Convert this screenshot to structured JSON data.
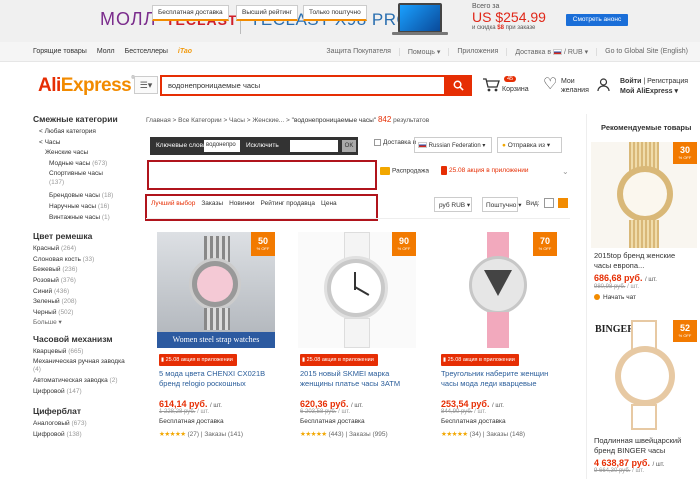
{
  "banner": {
    "mall": "МОЛЛ",
    "brand": "TECLAST",
    "product": "TECLAST X98 PRO",
    "offer_line1": "Всего за",
    "offer_price": "US $254.99",
    "offer_line3_prefix": "и скидка",
    "offer_line3_amount": "$8",
    "offer_line3_suffix": "при заказе",
    "cta": "Смотреть анонс"
  },
  "topnav": {
    "left": [
      "Горящие товары",
      "Молл",
      "Бестселлеры",
      "iTao"
    ],
    "right": [
      "Защита Покупателя",
      "Помощь ▾",
      "Приложения",
      "Доставка в",
      "/ RUB ▾",
      "Go to Global Site (English)"
    ]
  },
  "header": {
    "logo_main": "Ali",
    "logo_accent": "Express",
    "logo_reg": "®",
    "search_value": "водонепроницаемые часы",
    "cart_count": "45",
    "cart_label": "Корзина",
    "wish_label": "Мои желания",
    "account_line1a": "Войти",
    "account_line1b": "Регистрация",
    "account_line2": "Мой AliExpress ▾"
  },
  "sidebar": {
    "heading_categories": "Смежные категории",
    "categories": [
      {
        "label": "< Любая категория",
        "count": "",
        "level": 1
      },
      {
        "label": "< Часы",
        "count": "",
        "level": 2
      },
      {
        "label": "Женские часы",
        "count": "",
        "level": 2
      },
      {
        "label": "Модные часы",
        "count": "(673)",
        "level": 3
      },
      {
        "label": "Спортивные часы",
        "count": "(137)",
        "level": 3
      },
      {
        "label": "Брендовые часы",
        "count": "(18)",
        "level": 3
      },
      {
        "label": "Наручные часы",
        "count": "(16)",
        "level": 3
      },
      {
        "label": "Винтажные часы",
        "count": "(1)",
        "level": 3
      }
    ],
    "heading_strap": "Цвет ремешка",
    "strap": [
      {
        "label": "Красный",
        "count": "(264)"
      },
      {
        "label": "Слоновая кость",
        "count": "(33)"
      },
      {
        "label": "Бежевый",
        "count": "(236)"
      },
      {
        "label": "Розовый",
        "count": "(376)"
      },
      {
        "label": "Синий",
        "count": "(436)"
      },
      {
        "label": "Зеленый",
        "count": "(208)"
      },
      {
        "label": "Черный",
        "count": "(502)"
      }
    ],
    "more": "Больше ▾",
    "heading_mech": "Часовой механизм",
    "mech": [
      {
        "label": "Кварцевый",
        "count": "(665)"
      },
      {
        "label": "Механическая ручная заводка",
        "count": "(4)"
      },
      {
        "label": "Автоматическая заводка",
        "count": "(2)"
      },
      {
        "label": "Цифровой",
        "count": "(147)"
      }
    ],
    "heading_dial": "Циферблат",
    "dial": [
      {
        "label": "Аналоговый",
        "count": "(673)"
      },
      {
        "label": "Цифровой",
        "count": "(138)"
      }
    ]
  },
  "main": {
    "breadcrumb": "Главная > Все Категории > Часы > Женские... >",
    "query": "\"водонепроницаемые часы\"",
    "result_count": "842",
    "result_label": "результатов",
    "kw_label": "Ключевые слова",
    "kw_value": "водонепро",
    "exclude_label": "Исключить",
    "ok": "OK",
    "ship_to_label": "Доставка в",
    "ship_to_value": "Russian Federation",
    "ship_from": "Отправка из",
    "filters": [
      "Бесплатная доставка",
      "Высший рейтинг",
      "Только поштучно"
    ],
    "sale": "Распродажа",
    "app_deal": "25.08 акция в приложении",
    "sort": [
      "Лучший выбор",
      "Заказы",
      "Новинки",
      "Рейтинг продавца",
      "Цена"
    ],
    "currency": "руб RUB",
    "ship_sort": "Поштучно",
    "view_label": "Вид:"
  },
  "products": [
    {
      "discount": "50",
      "off": "% OFF",
      "promo": "25.08 акция в приложении",
      "title": "5 мода цвета CHENXI CX021B бренд relogio роскошных",
      "price": "614,14 руб.",
      "unit": "/ шт.",
      "old": "1 228,28 руб.",
      "old_unit": "/ шт.",
      "shipping": "Бесплатная доставка",
      "stars": "★★★★★",
      "reviews": "(27)",
      "orders": "Заказы (141)",
      "img_caption": "Women steel strap watches"
    },
    {
      "discount": "90",
      "off": "% OFF",
      "promo": "25.08 акция в приложении",
      "title": "2015 новый SKMEI марка женщины платье часы 3ATM",
      "price": "620,36 руб.",
      "unit": "/ шт.",
      "old": "6 203,58 руб.",
      "old_unit": "/ шт.",
      "shipping": "Бесплатная доставка",
      "stars": "★★★★★",
      "reviews": "(443)",
      "orders": "Заказы (995)"
    },
    {
      "discount": "70",
      "off": "% OFF",
      "promo": "25.08 акция в приложении",
      "title": "Треугольник наберите женщин часы мода леди кварцевые",
      "price": "253,54 руб.",
      "unit": "/ шт.",
      "old": "844,90 руб.",
      "old_unit": "/ шт.",
      "shipping": "Бесплатная доставка",
      "stars": "★★★★★",
      "reviews": "(34)",
      "orders": "Заказы (148)"
    }
  ],
  "rail": {
    "heading": "Рекомендуемые товары",
    "item1": {
      "discount": "30",
      "off": "% OFF",
      "title": "2015top бренд женские часы европа...",
      "price": "686,68 руб.",
      "unit": "/ шт.",
      "old": "980,98 руб.",
      "old_unit": "/ шт.",
      "chat": "Начать чат"
    },
    "item2": {
      "discount": "52",
      "off": "% OFF",
      "brand": "BINGER",
      "title": "Подлинная швейцарский бренд BINGER часы",
      "price": "4 638,87 руб.",
      "unit": "/ шт.",
      "old": "9 664,30 руб.",
      "old_unit": "/ шт."
    }
  },
  "colors": {
    "accent": "#e62e04",
    "orange": "#f28b00",
    "highlight_box": "#b0141c"
  }
}
